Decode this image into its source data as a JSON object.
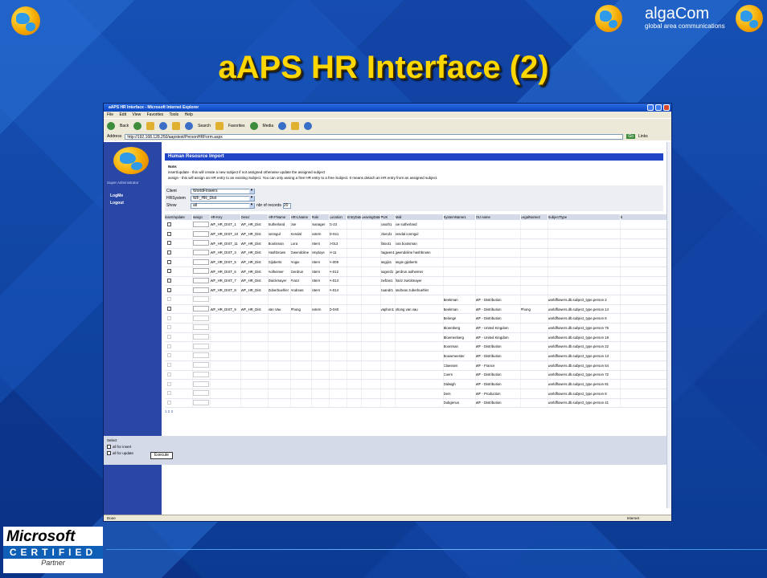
{
  "slide": {
    "title": "aAPS HR Interface (2)",
    "brand_name": "algaCom",
    "brand_tagline": "global area communications",
    "ms_brand": "Microsoft",
    "ms_certified": "CERTIFIED",
    "ms_partner": "Partner"
  },
  "browser": {
    "title": "aAPS HR Interface - Microsoft Internet Explorer",
    "menu": [
      "File",
      "Edit",
      "View",
      "Favorites",
      "Tools",
      "Help"
    ],
    "toolbar": [
      "Back",
      "Search",
      "Favorites",
      "Media"
    ],
    "address_label": "Address",
    "address": "http://192.168.128.250/aapstest/PersonHRForm.aspx",
    "go": "Go",
    "links": "Links",
    "status": "Done",
    "zone": "Internet"
  },
  "sidebar": {
    "user": "Super Administrator",
    "items": [
      "LogMe",
      "Logout"
    ]
  },
  "page": {
    "header": "Human Resource Import",
    "note_label": "Note:",
    "note_insert": "insert/update -  this will create a new subject if not assigned otherwise update the assigned subject",
    "note_assign": "assign -            this will assign an HR entry to an existing Subject. You can only assing a free HR entry to a free Subject. 0 means detach an HR entry from an assigned subject.",
    "client_label": "Client",
    "client_value": "WorldFlowers",
    "hrsystem_label": "HRSystem",
    "hrsystem_value": "WF_HR_Dist",
    "show_label": "Show",
    "show_value": "all",
    "records_label": "nbr of records",
    "records_value": "20",
    "pager": "1 2 3",
    "select_label": "Select",
    "all_insert": "all for insert",
    "all_update": "all for update",
    "execute": "Execute"
  },
  "table": {
    "columns": [
      "insert/update",
      "assign",
      "HR-Key",
      "Descr",
      "HR-FName",
      "HR-LName",
      "Role",
      "Location",
      "EntryDate",
      "LeavingDate",
      "PUK",
      "Mail",
      "SystemName1",
      "OU name",
      "LegalName2",
      "SubjectType",
      "E"
    ],
    "rows": [
      {
        "key": "WF_HR_DIST_1",
        "descr": "WF_HR_Dist",
        "fname": "Sutherland",
        "lname": "Joe",
        "role": "manager",
        "loc": "G-23",
        "puk": "josuth1",
        "mail": "joe sutherland",
        "sys": "",
        "ou": "",
        "legal": "",
        "stype": ""
      },
      {
        "key": "WF_HR_DIST_10",
        "descr": "WF_HR_Dist",
        "fname": "Ionmgul",
        "lname": "Kendal",
        "role": "extern",
        "loc": "D-041",
        "puk": "ckend1",
        "mail": "kendal ionmgul",
        "sys": "",
        "ou": "",
        "legal": "",
        "stype": ""
      },
      {
        "key": "WF_HR_DIST_11",
        "descr": "WF_HR_Dist",
        "fname": "Bootsman",
        "lname": "Lora",
        "role": "intern",
        "loc": "J-013",
        "puk": "lbtoot1",
        "mail": "lora bootsman",
        "sys": "",
        "ou": "",
        "legal": "",
        "stype": ""
      },
      {
        "key": "WF_HR_DIST_3",
        "descr": "WF_HR_Dist",
        "fname": "Hashbrown",
        "lname": "Gwendoline",
        "role": "employe",
        "loc": "H-11",
        "puk": "hagwen1",
        "mail": "gwendoline hashbrown",
        "sys": "",
        "ou": "",
        "legal": "",
        "stype": ""
      },
      {
        "key": "WF_HR_DIST_5",
        "descr": "WF_HR_Dist",
        "fname": "Gijsberts",
        "lname": "Angie",
        "role": "intern",
        "loc": "A-009",
        "puk": "angijs1",
        "mail": "angie gijsberts",
        "sys": "",
        "ou": "",
        "legal": "",
        "stype": ""
      },
      {
        "key": "WF_HR_DIST_6",
        "descr": "WF_HR_Dist",
        "fname": "Aolheimer",
        "lname": "Gerdrun",
        "role": "intern",
        "loc": "A-012",
        "puk": "aogerd1",
        "mail": "gerdrun aolheimer",
        "sys": "",
        "ou": "",
        "legal": "",
        "stype": ""
      },
      {
        "key": "WF_HR_DIST_7",
        "descr": "WF_HR_Dist",
        "fname": "Zwickmayer",
        "lname": "Franz",
        "role": "intern",
        "loc": "A-013",
        "puk": "zwfran1",
        "mail": "franz zwickmayer",
        "sys": "",
        "ou": "",
        "legal": "",
        "stype": ""
      },
      {
        "key": "WF_HR_DIST_8",
        "descr": "WF_HR_Dist",
        "fname": "Zuberbuehler",
        "lname": "Andreas",
        "role": "intern",
        "loc": "A-014",
        "puk": "zuandr1",
        "mail": "andreas zuberbuehler",
        "sys": "",
        "ou": "",
        "legal": "",
        "stype": ""
      },
      {
        "key": "",
        "descr": "",
        "fname": "",
        "lname": "",
        "role": "",
        "loc": "",
        "puk": "",
        "mail": "",
        "sys": "Beekman",
        "ou": "WF - Distribution",
        "legal": "",
        "stype": "worldflowers.db.subject_type.person 2"
      },
      {
        "key": "WF_HR_DIST_9",
        "descr": "WF_HR_Dist",
        "fname": "Van Vau",
        "lname": "Phong",
        "role": "extern",
        "loc": "D-040",
        "puk": "vaphon1",
        "mail": "phong van vau",
        "sys": "Beekman",
        "ou": "WF - Distribution",
        "legal": "Phong",
        "stype": "worldflowers.db.subject_type.person 14"
      },
      {
        "key": "",
        "descr": "",
        "fname": "",
        "lname": "",
        "role": "",
        "loc": "",
        "puk": "",
        "mail": "",
        "sys": "Belonge",
        "ou": "WF - Distribution",
        "legal": "",
        "stype": "worldflowers.db.subject_type.person 6"
      },
      {
        "key": "",
        "descr": "",
        "fname": "",
        "lname": "",
        "role": "",
        "loc": "",
        "puk": "",
        "mail": "",
        "sys": "Bloemberg",
        "ou": "WF - United Kingdom",
        "legal": "",
        "stype": "worldflowers.db.subject_type.person 75"
      },
      {
        "key": "",
        "descr": "",
        "fname": "",
        "lname": "",
        "role": "",
        "loc": "",
        "puk": "",
        "mail": "",
        "sys": "Bloemenberg",
        "ou": "WF - United Kingdom",
        "legal": "",
        "stype": "worldflowers.db.subject_type.person 19"
      },
      {
        "key": "",
        "descr": "",
        "fname": "",
        "lname": "",
        "role": "",
        "loc": "",
        "puk": "",
        "mail": "",
        "sys": "Boonman",
        "ou": "WF - Distribution",
        "legal": "",
        "stype": "worldflowers.db.subject_type.person 22"
      },
      {
        "key": "",
        "descr": "",
        "fname": "",
        "lname": "",
        "role": "",
        "loc": "",
        "puk": "",
        "mail": "",
        "sys": "Bouwmeester",
        "ou": "WF - Distribution",
        "legal": "",
        "stype": "worldflowers.db.subject_type.person 13"
      },
      {
        "key": "",
        "descr": "",
        "fname": "",
        "lname": "",
        "role": "",
        "loc": "",
        "puk": "",
        "mail": "",
        "sys": "Claessen",
        "ou": "WF - France",
        "legal": "",
        "stype": "worldflowers.db.subject_type.person 54"
      },
      {
        "key": "",
        "descr": "",
        "fname": "",
        "lname": "",
        "role": "",
        "loc": "",
        "puk": "",
        "mail": "",
        "sys": "Coers",
        "ou": "WF - Distribution",
        "legal": "",
        "stype": "worldflowers.db.subject_type.person 72"
      },
      {
        "key": "",
        "descr": "",
        "fname": "",
        "lname": "",
        "role": "",
        "loc": "",
        "puk": "",
        "mail": "",
        "sys": "Dalwigh",
        "ou": "WF - Distribution",
        "legal": "",
        "stype": "worldflowers.db.subject_type.person 81"
      },
      {
        "key": "",
        "descr": "",
        "fname": "",
        "lname": "",
        "role": "",
        "loc": "",
        "puk": "",
        "mail": "",
        "sys": "Ders",
        "ou": "WF - Production",
        "legal": "",
        "stype": "worldflowers.db.subject_type.person 8"
      },
      {
        "key": "",
        "descr": "",
        "fname": "",
        "lname": "",
        "role": "",
        "loc": "",
        "puk": "",
        "mail": "",
        "sys": "Dubgenus",
        "ou": "WF - Distribution",
        "legal": "",
        "stype": "worldflowers.db.subject_type.person 41"
      }
    ]
  }
}
